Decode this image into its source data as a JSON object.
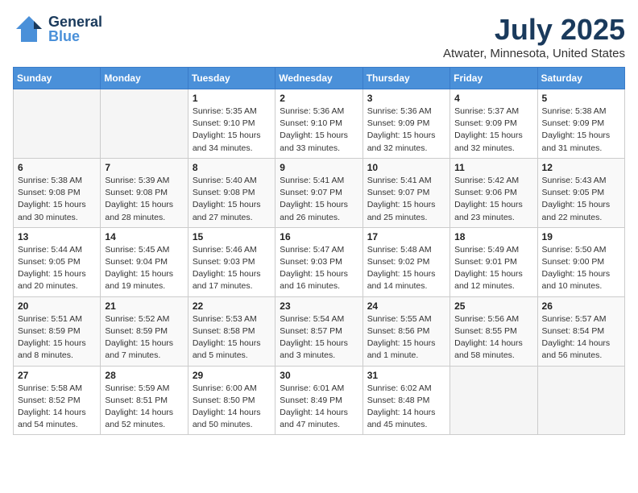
{
  "header": {
    "logo_general": "General",
    "logo_blue": "Blue",
    "month_year": "July 2025",
    "location": "Atwater, Minnesota, United States"
  },
  "weekdays": [
    "Sunday",
    "Monday",
    "Tuesday",
    "Wednesday",
    "Thursday",
    "Friday",
    "Saturday"
  ],
  "weeks": [
    [
      {
        "day": "",
        "empty": true
      },
      {
        "day": "",
        "empty": true
      },
      {
        "day": "1",
        "sunrise": "Sunrise: 5:35 AM",
        "sunset": "Sunset: 9:10 PM",
        "daylight": "Daylight: 15 hours and 34 minutes."
      },
      {
        "day": "2",
        "sunrise": "Sunrise: 5:36 AM",
        "sunset": "Sunset: 9:10 PM",
        "daylight": "Daylight: 15 hours and 33 minutes."
      },
      {
        "day": "3",
        "sunrise": "Sunrise: 5:36 AM",
        "sunset": "Sunset: 9:09 PM",
        "daylight": "Daylight: 15 hours and 32 minutes."
      },
      {
        "day": "4",
        "sunrise": "Sunrise: 5:37 AM",
        "sunset": "Sunset: 9:09 PM",
        "daylight": "Daylight: 15 hours and 32 minutes."
      },
      {
        "day": "5",
        "sunrise": "Sunrise: 5:38 AM",
        "sunset": "Sunset: 9:09 PM",
        "daylight": "Daylight: 15 hours and 31 minutes."
      }
    ],
    [
      {
        "day": "6",
        "sunrise": "Sunrise: 5:38 AM",
        "sunset": "Sunset: 9:08 PM",
        "daylight": "Daylight: 15 hours and 30 minutes."
      },
      {
        "day": "7",
        "sunrise": "Sunrise: 5:39 AM",
        "sunset": "Sunset: 9:08 PM",
        "daylight": "Daylight: 15 hours and 28 minutes."
      },
      {
        "day": "8",
        "sunrise": "Sunrise: 5:40 AM",
        "sunset": "Sunset: 9:08 PM",
        "daylight": "Daylight: 15 hours and 27 minutes."
      },
      {
        "day": "9",
        "sunrise": "Sunrise: 5:41 AM",
        "sunset": "Sunset: 9:07 PM",
        "daylight": "Daylight: 15 hours and 26 minutes."
      },
      {
        "day": "10",
        "sunrise": "Sunrise: 5:41 AM",
        "sunset": "Sunset: 9:07 PM",
        "daylight": "Daylight: 15 hours and 25 minutes."
      },
      {
        "day": "11",
        "sunrise": "Sunrise: 5:42 AM",
        "sunset": "Sunset: 9:06 PM",
        "daylight": "Daylight: 15 hours and 23 minutes."
      },
      {
        "day": "12",
        "sunrise": "Sunrise: 5:43 AM",
        "sunset": "Sunset: 9:05 PM",
        "daylight": "Daylight: 15 hours and 22 minutes."
      }
    ],
    [
      {
        "day": "13",
        "sunrise": "Sunrise: 5:44 AM",
        "sunset": "Sunset: 9:05 PM",
        "daylight": "Daylight: 15 hours and 20 minutes."
      },
      {
        "day": "14",
        "sunrise": "Sunrise: 5:45 AM",
        "sunset": "Sunset: 9:04 PM",
        "daylight": "Daylight: 15 hours and 19 minutes."
      },
      {
        "day": "15",
        "sunrise": "Sunrise: 5:46 AM",
        "sunset": "Sunset: 9:03 PM",
        "daylight": "Daylight: 15 hours and 17 minutes."
      },
      {
        "day": "16",
        "sunrise": "Sunrise: 5:47 AM",
        "sunset": "Sunset: 9:03 PM",
        "daylight": "Daylight: 15 hours and 16 minutes."
      },
      {
        "day": "17",
        "sunrise": "Sunrise: 5:48 AM",
        "sunset": "Sunset: 9:02 PM",
        "daylight": "Daylight: 15 hours and 14 minutes."
      },
      {
        "day": "18",
        "sunrise": "Sunrise: 5:49 AM",
        "sunset": "Sunset: 9:01 PM",
        "daylight": "Daylight: 15 hours and 12 minutes."
      },
      {
        "day": "19",
        "sunrise": "Sunrise: 5:50 AM",
        "sunset": "Sunset: 9:00 PM",
        "daylight": "Daylight: 15 hours and 10 minutes."
      }
    ],
    [
      {
        "day": "20",
        "sunrise": "Sunrise: 5:51 AM",
        "sunset": "Sunset: 8:59 PM",
        "daylight": "Daylight: 15 hours and 8 minutes."
      },
      {
        "day": "21",
        "sunrise": "Sunrise: 5:52 AM",
        "sunset": "Sunset: 8:59 PM",
        "daylight": "Daylight: 15 hours and 7 minutes."
      },
      {
        "day": "22",
        "sunrise": "Sunrise: 5:53 AM",
        "sunset": "Sunset: 8:58 PM",
        "daylight": "Daylight: 15 hours and 5 minutes."
      },
      {
        "day": "23",
        "sunrise": "Sunrise: 5:54 AM",
        "sunset": "Sunset: 8:57 PM",
        "daylight": "Daylight: 15 hours and 3 minutes."
      },
      {
        "day": "24",
        "sunrise": "Sunrise: 5:55 AM",
        "sunset": "Sunset: 8:56 PM",
        "daylight": "Daylight: 15 hours and 1 minute."
      },
      {
        "day": "25",
        "sunrise": "Sunrise: 5:56 AM",
        "sunset": "Sunset: 8:55 PM",
        "daylight": "Daylight: 14 hours and 58 minutes."
      },
      {
        "day": "26",
        "sunrise": "Sunrise: 5:57 AM",
        "sunset": "Sunset: 8:54 PM",
        "daylight": "Daylight: 14 hours and 56 minutes."
      }
    ],
    [
      {
        "day": "27",
        "sunrise": "Sunrise: 5:58 AM",
        "sunset": "Sunset: 8:52 PM",
        "daylight": "Daylight: 14 hours and 54 minutes."
      },
      {
        "day": "28",
        "sunrise": "Sunrise: 5:59 AM",
        "sunset": "Sunset: 8:51 PM",
        "daylight": "Daylight: 14 hours and 52 minutes."
      },
      {
        "day": "29",
        "sunrise": "Sunrise: 6:00 AM",
        "sunset": "Sunset: 8:50 PM",
        "daylight": "Daylight: 14 hours and 50 minutes."
      },
      {
        "day": "30",
        "sunrise": "Sunrise: 6:01 AM",
        "sunset": "Sunset: 8:49 PM",
        "daylight": "Daylight: 14 hours and 47 minutes."
      },
      {
        "day": "31",
        "sunrise": "Sunrise: 6:02 AM",
        "sunset": "Sunset: 8:48 PM",
        "daylight": "Daylight: 14 hours and 45 minutes."
      },
      {
        "day": "",
        "empty": true
      },
      {
        "day": "",
        "empty": true
      }
    ]
  ]
}
